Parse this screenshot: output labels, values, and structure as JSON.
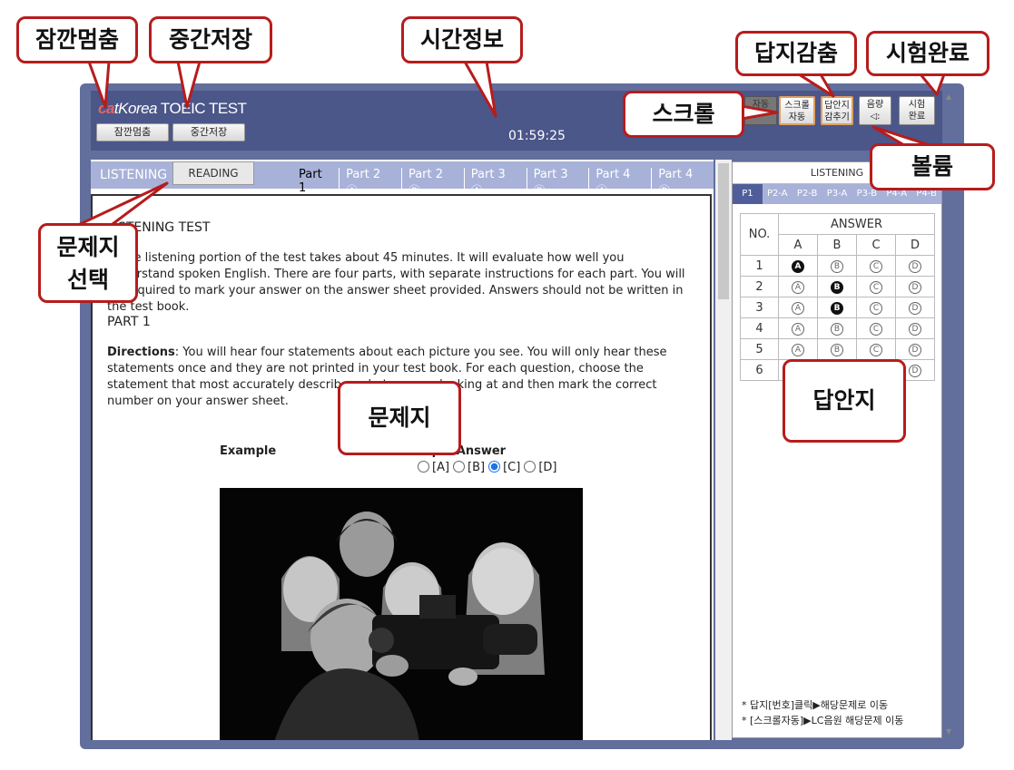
{
  "header": {
    "logo_brand_a": "ca",
    "logo_brand_b": "tKorea",
    "logo_rest": " TOEIC TEST",
    "pause_button": "잠깐멈춤",
    "save_button": "중간저장",
    "timer": "01:59:25",
    "tools": {
      "hidden_label": "자동",
      "scroll_line1": "스크롤",
      "scroll_line2": "자동",
      "hide_line1": "답안지",
      "hide_line2": "감추기",
      "volume_line1": "음량",
      "volume_icon": "◁:",
      "end_line1": "시험",
      "end_line2": "완료"
    }
  },
  "sections": {
    "listening": "LISTENING",
    "reading": "READING",
    "parts": [
      "Part 1",
      "Part 2 Ⓐ",
      "Part 2 Ⓑ",
      "Part 3 Ⓐ",
      "Part 3 Ⓑ",
      "Part 4 Ⓐ",
      "Part 4 Ⓑ"
    ]
  },
  "question": {
    "title": "LISTENING TEST",
    "intro": "In the listening portion of the test takes about 45 minutes. It will evaluate how well you understand spoken English. There are four parts, with separate instructions for each part. You will be required to mark your answer on the answer sheet provided. Answers should not be written in the test book.",
    "part_heading": "PART 1",
    "directions_label": "Directions",
    "directions_text": ": You will hear four statements about each picture you see. You will only hear these statements once and they are not printed in your test book. For each question, choose the statement that most accurately describes what you are looking at and then mark the correct number on your answer sheet.",
    "example_label": "Example",
    "sample_answer_label": "Sample Answer",
    "options": [
      "[A]",
      "[B]",
      "[C]",
      "[D]"
    ],
    "selected_option": "[C]"
  },
  "answer_sheet": {
    "section": "LISTENING",
    "tabs": [
      "P1",
      "P2-A",
      "P2-B",
      "P3-A",
      "P3-B",
      "P4-A",
      "P4-B"
    ],
    "active_tab": "P1",
    "no_header": "NO.",
    "answer_header": "ANSWER",
    "choices": [
      "A",
      "B",
      "C",
      "D"
    ],
    "bubble_glyphs": [
      "Ⓐ",
      "Ⓑ",
      "Ⓒ",
      "Ⓓ"
    ],
    "rows": [
      {
        "no": "1",
        "marked": "A"
      },
      {
        "no": "2",
        "marked": "B"
      },
      {
        "no": "3",
        "marked": "B"
      },
      {
        "no": "4",
        "marked": ""
      },
      {
        "no": "5",
        "marked": ""
      },
      {
        "no": "6",
        "marked": ""
      }
    ],
    "note1": "* 답지[번호]클릭▶해당문제로 이동",
    "note2": "* [스크롤자동]▶LC음원 해당문제 이동"
  },
  "callouts": {
    "pause": "잠깐멈춤",
    "save": "중간저장",
    "time": "시간정보",
    "hide": "답지감춤",
    "end": "시험완료",
    "scroll": "스크롤",
    "volume": "볼륨",
    "select_line1": "문제지",
    "select_line2": "선택",
    "question_paper": "문제지",
    "answer_sheet": "답안지"
  },
  "colors": {
    "frame": "#626e9c",
    "header": "#4b5689",
    "tab_bar": "#a8b2d8",
    "callout_border": "#b71c1c"
  }
}
